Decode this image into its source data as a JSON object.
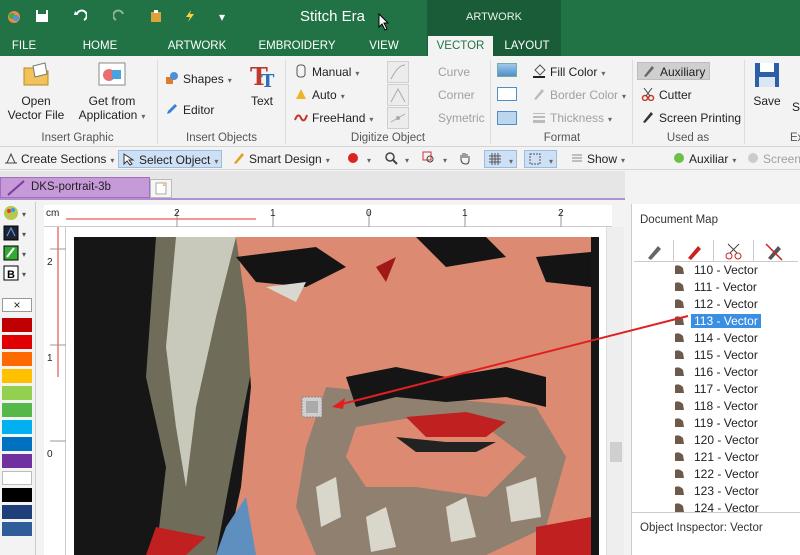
{
  "app": {
    "title": "Stitch Era",
    "context_tab_group": "ARTWORK"
  },
  "tabs": [
    {
      "label": "FILE"
    },
    {
      "label": "HOME"
    },
    {
      "label": "ARTWORK"
    },
    {
      "label": "EMBROIDERY"
    },
    {
      "label": "VIEW"
    },
    {
      "label": "VECTOR"
    },
    {
      "label": "LAYOUT"
    }
  ],
  "ribbon": {
    "insert_graphic": {
      "label": "Insert Graphic",
      "open_vector": "Open\nVector File",
      "get_from_app_1": "Get from",
      "get_from_app_2": "Application"
    },
    "insert_objects": {
      "label": "Insert Objects",
      "shapes": "Shapes",
      "editor": "Editor",
      "text": "Text"
    },
    "digitize_object": {
      "label": "Digitize Object",
      "manual": "Manual",
      "auto": "Auto",
      "freehand": "FreeHand",
      "curve": "Curve",
      "corner": "Corner",
      "symetric": "Symetric"
    },
    "format": {
      "label": "Format",
      "fill_color": "Fill Color",
      "border_color": "Border Color",
      "thickness": "Thickness"
    },
    "used_as": {
      "label": "Used as",
      "auxiliary": "Auxiliary",
      "cutter": "Cutter",
      "screen_printing": "Screen Printing"
    },
    "save": {
      "label": "Ex",
      "save": "Save",
      "partial": "S"
    }
  },
  "toolbar2": {
    "create_sections": "Create Sections",
    "select_object": "Select Object",
    "smart_design": "Smart Design",
    "show": "Show",
    "auxiliar": "Auxiliar",
    "screen": "Screen"
  },
  "document": {
    "tab_name": "DKS-portrait-3b",
    "ruler_unit": "cm",
    "h_ticks": [
      "2",
      "1",
      "0",
      "1",
      "2"
    ],
    "v_ticks": [
      "2",
      "1",
      "0"
    ]
  },
  "palette": {
    "colors": [
      "#c00000",
      "#e00000",
      "#ff6a00",
      "#ffc000",
      "#92d050",
      "#55b848",
      "#00b0f0",
      "#0070c0",
      "#7030a0",
      "#ffffff",
      "#000000",
      "#1f3f7a",
      "#2e5d9a"
    ]
  },
  "document_map": {
    "title": "Document Map",
    "items": [
      {
        "label": "110 - Vector",
        "selected": false
      },
      {
        "label": "111 - Vector",
        "selected": false
      },
      {
        "label": "112 - Vector",
        "selected": false
      },
      {
        "label": "113 - Vector",
        "selected": true
      },
      {
        "label": "114 - Vector",
        "selected": false
      },
      {
        "label": "115 - Vector",
        "selected": false
      },
      {
        "label": "116 - Vector",
        "selected": false
      },
      {
        "label": "117 - Vector",
        "selected": false
      },
      {
        "label": "118 - Vector",
        "selected": false
      },
      {
        "label": "119 - Vector",
        "selected": false
      },
      {
        "label": "120 - Vector",
        "selected": false
      },
      {
        "label": "121 - Vector",
        "selected": false
      },
      {
        "label": "122 - Vector",
        "selected": false
      },
      {
        "label": "123 - Vector",
        "selected": false
      },
      {
        "label": "124 - Vector",
        "selected": false
      }
    ]
  },
  "object_inspector": {
    "title": "Object Inspector: Vector"
  },
  "colors": {
    "brand": "#217346",
    "selection": "#3b8fe3",
    "doc_tab": "#c69ad9",
    "annotation_arrow": "#e02020"
  }
}
